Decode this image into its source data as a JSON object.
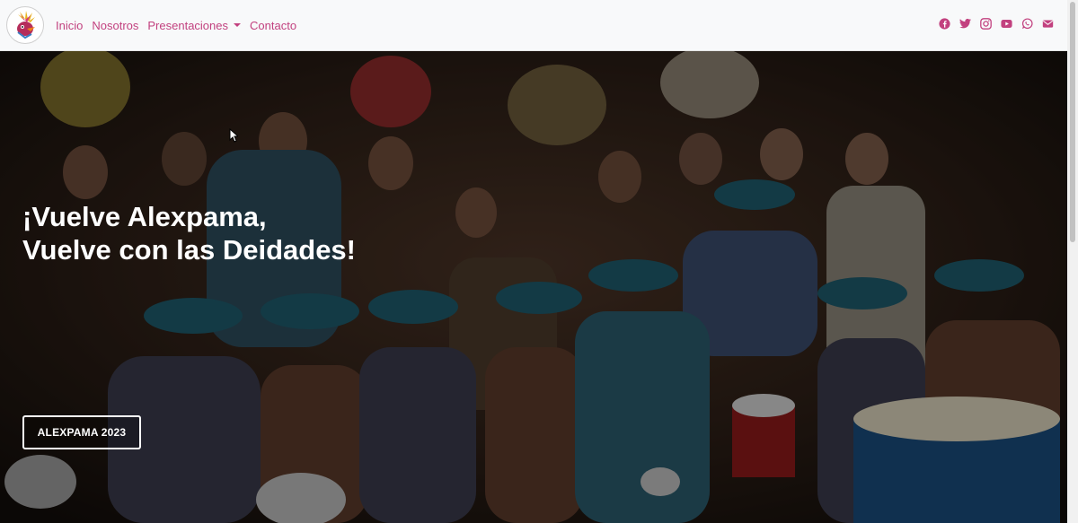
{
  "navbar": {
    "logo_icon": "alexpama-logo-icon",
    "links": [
      {
        "label": "Inicio"
      },
      {
        "label": "Nosotros"
      },
      {
        "label": "Presentaciones",
        "has_dropdown": true
      },
      {
        "label": "Contacto"
      }
    ],
    "social_icons": [
      "facebook-icon",
      "twitter-icon",
      "instagram-icon",
      "youtube-icon",
      "whatsapp-icon",
      "email-icon"
    ],
    "link_color": "#c2417f"
  },
  "hero": {
    "title_line1": "¡Vuelve Alexpama,",
    "title_line2": "Vuelve con las Deidades!",
    "button_label": "ALEXPAMA 2023"
  }
}
